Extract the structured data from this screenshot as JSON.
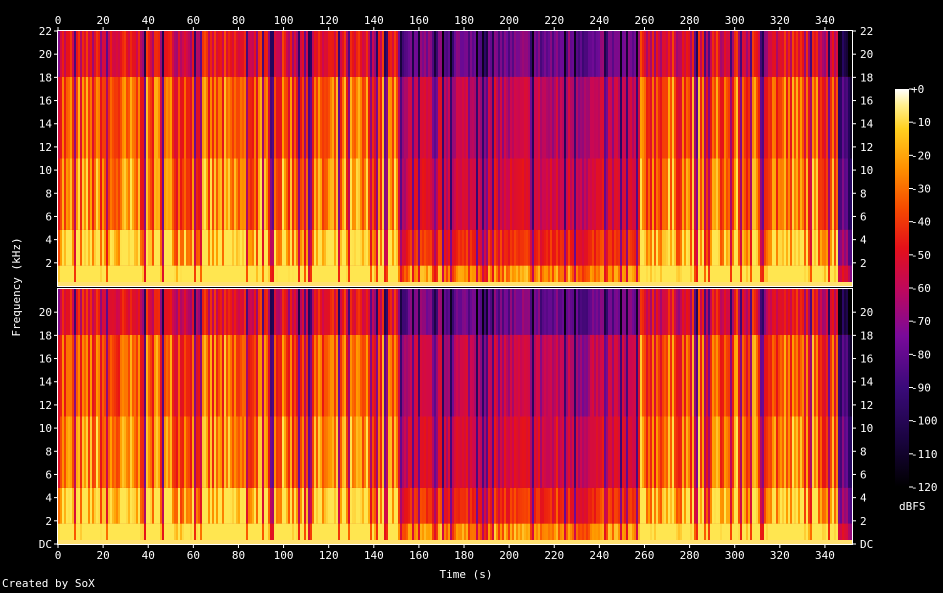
{
  "footer": "Created by SoX",
  "chart_data": {
    "type": "heatmap",
    "title": "",
    "xlabel": "Time (s)",
    "ylabel": "Frequency (kHz)",
    "xlim": [
      0,
      352
    ],
    "ylim": [
      0,
      22
    ],
    "x_ticks": [
      0,
      20,
      40,
      60,
      80,
      100,
      120,
      140,
      160,
      180,
      200,
      220,
      240,
      260,
      280,
      300,
      320,
      340
    ],
    "y_ticks": [
      2,
      4,
      6,
      8,
      10,
      12,
      14,
      16,
      18,
      20,
      22
    ],
    "y_tick_labels_top": [
      "2",
      "4",
      "6",
      "8",
      "10",
      "12",
      "14",
      "16",
      "18",
      "20",
      "22"
    ],
    "y_tick_labels_bottom": [
      "DC",
      "2",
      "4",
      "6",
      "8",
      "10",
      "12",
      "14",
      "16",
      "18",
      "20"
    ],
    "channels": 2,
    "colorbar": {
      "label": "dBFS",
      "ticks": [
        "+0",
        "-10",
        "-20",
        "-30",
        "-40",
        "-50",
        "-60",
        "-70",
        "-80",
        "-90",
        "-100",
        "-110",
        "-120"
      ],
      "range": [
        -120,
        0
      ]
    },
    "segments": [
      {
        "start": 0,
        "end": 150,
        "level": "loud"
      },
      {
        "start": 150,
        "end": 258,
        "level": "quieter"
      },
      {
        "start": 258,
        "end": 345,
        "level": "loud"
      },
      {
        "start": 345,
        "end": 352,
        "level": "fade-out"
      }
    ]
  }
}
